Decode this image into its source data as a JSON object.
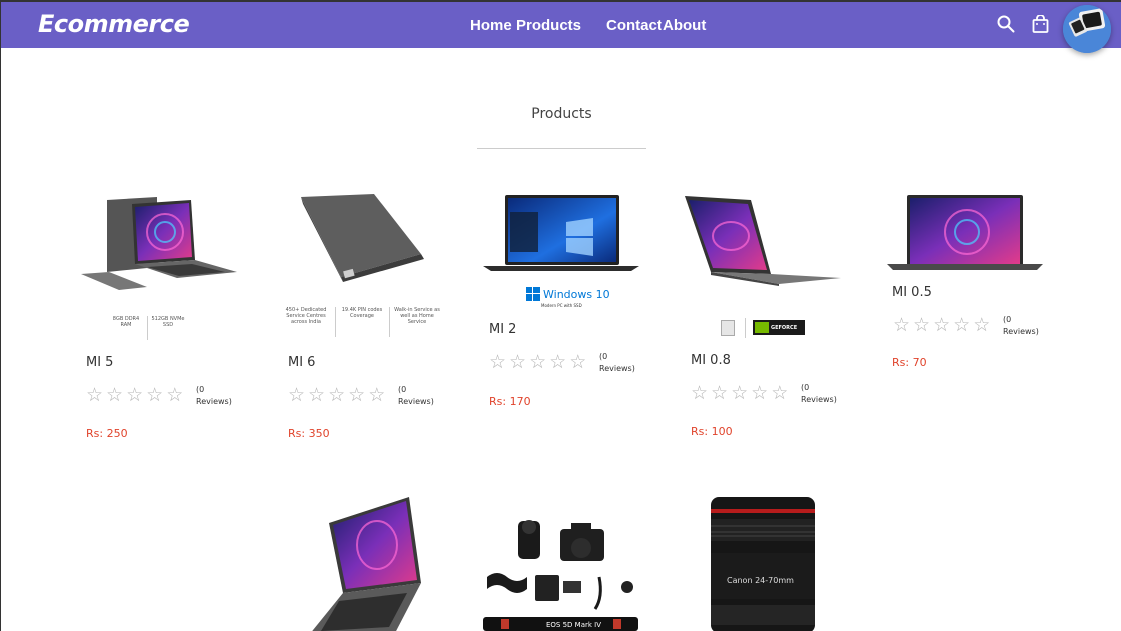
{
  "brand": {
    "name": "Ecommerce"
  },
  "nav": {
    "links": [
      "Home",
      "Products",
      "Contact",
      "About"
    ],
    "icons": [
      "search-icon",
      "shopping-bag-icon"
    ]
  },
  "section": {
    "title": "Products"
  },
  "products": [
    {
      "name": "MI 5",
      "reviews": "(0 Reviews)",
      "price": "Rs: 250",
      "rating": 0,
      "specs": [
        "8GB DDR4 RAM",
        "512GB NVMe SSD"
      ]
    },
    {
      "name": "MI 6",
      "reviews": "(0 Reviews)",
      "price": "Rs: 350",
      "rating": 0,
      "specs": [
        "450+ Dedicated Service Centres across India",
        "19.4K PIN codes Coverage",
        "Walk-in Service as well as Home Service"
      ]
    },
    {
      "name": "MI 2",
      "reviews": "(0 Reviews)",
      "price": "Rs: 170",
      "rating": 0,
      "badge": "Windows 10",
      "badge_sub": "Modern PC with SSD"
    },
    {
      "name": "MI 0.8",
      "reviews": "(0 Reviews)",
      "price": "Rs: 100",
      "rating": 0,
      "badge": "GEFORCE"
    },
    {
      "name": "MI 0.5",
      "reviews": "(0 Reviews)",
      "price": "Rs: 70",
      "rating": 0
    }
  ],
  "camera_text": {
    "strap": "EOS 5D Mark IV",
    "lens": "Canon 24-70mm"
  },
  "colors": {
    "navbar": "#6a5fc6",
    "price": "#e0432b",
    "star": "#b5b5b5"
  }
}
